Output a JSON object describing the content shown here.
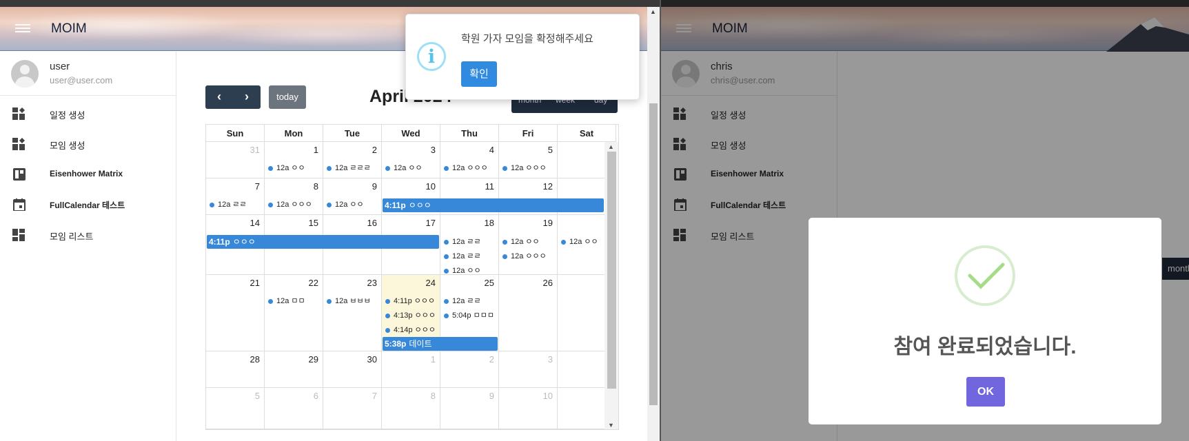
{
  "left_window": {
    "app_title": "MOIM",
    "user": {
      "name": "user",
      "email": "user@user.com"
    },
    "nav": [
      {
        "label": "일정 생성",
        "icon": "dashboard-add-icon"
      },
      {
        "label": "모임 생성",
        "icon": "dashboard-add-icon"
      },
      {
        "label": "Eisenhower Matrix",
        "icon": "board-icon"
      },
      {
        "label": "FullCalendar 테스트",
        "icon": "calendar-icon"
      },
      {
        "label": "모임 리스트",
        "icon": "dashboard-icon"
      }
    ],
    "calendar": {
      "prev": "‹",
      "next": "›",
      "today": "today",
      "title": "April 2024",
      "views": [
        "month",
        "week",
        "day"
      ],
      "dow": [
        "Sun",
        "Mon",
        "Tue",
        "Wed",
        "Thu",
        "Fri",
        "Sat"
      ],
      "weeks": [
        [
          {
            "d": "31",
            "o": true
          },
          {
            "d": "1"
          },
          {
            "d": "2"
          },
          {
            "d": "3"
          },
          {
            "d": "4"
          },
          {
            "d": "5"
          },
          {
            "d": ""
          }
        ],
        [
          {
            "d": "7"
          },
          {
            "d": "8"
          },
          {
            "d": "9"
          },
          {
            "d": "10"
          },
          {
            "d": "11"
          },
          {
            "d": "12"
          },
          {
            "d": ""
          }
        ],
        [
          {
            "d": "14"
          },
          {
            "d": "15"
          },
          {
            "d": "16"
          },
          {
            "d": "17"
          },
          {
            "d": "18"
          },
          {
            "d": "19"
          },
          {
            "d": ""
          }
        ],
        [
          {
            "d": "21"
          },
          {
            "d": "22"
          },
          {
            "d": "23"
          },
          {
            "d": "24",
            "today": true
          },
          {
            "d": "25"
          },
          {
            "d": "26"
          },
          {
            "d": ""
          }
        ],
        [
          {
            "d": "28"
          },
          {
            "d": "29"
          },
          {
            "d": "30"
          },
          {
            "d": "1",
            "o": true
          },
          {
            "d": "2",
            "o": true
          },
          {
            "d": "3",
            "o": true
          },
          {
            "d": ""
          }
        ],
        [
          {
            "d": "5",
            "o": true
          },
          {
            "d": "6",
            "o": true
          },
          {
            "d": "7",
            "o": true
          },
          {
            "d": "8",
            "o": true
          },
          {
            "d": "9",
            "o": true
          },
          {
            "d": "10",
            "o": true
          },
          {
            "d": ""
          }
        ]
      ],
      "events": [
        {
          "w": 0,
          "c": 1,
          "t": "12a ㅇㅇ"
        },
        {
          "w": 0,
          "c": 2,
          "t": "12a ㄹㄹㄹ"
        },
        {
          "w": 0,
          "c": 3,
          "t": "12a ㅇㅇ"
        },
        {
          "w": 0,
          "c": 4,
          "t": "12a ㅇㅇㅇ"
        },
        {
          "w": 0,
          "c": 5,
          "t": "12a ㅇㅇㅇ"
        },
        {
          "w": 1,
          "c": 0,
          "t": "12a ㄹㄹ"
        },
        {
          "w": 1,
          "c": 1,
          "t": "12a ㅇㅇㅇ"
        },
        {
          "w": 1,
          "c": 2,
          "t": "12a ㅇㅇ"
        },
        {
          "w": 2,
          "c": 4,
          "t": "12a ㄹㄹ"
        },
        {
          "w": 2,
          "c": 4,
          "t": "12a ㄹㄹ"
        },
        {
          "w": 2,
          "c": 4,
          "t": "12a ㅇㅇ"
        },
        {
          "w": 2,
          "c": 5,
          "t": "12a ㅇㅇ"
        },
        {
          "w": 2,
          "c": 5,
          "t": "12a ㅇㅇㅇ"
        },
        {
          "w": 2,
          "c": 6,
          "t": "12a ㅇㅇ"
        },
        {
          "w": 3,
          "c": 1,
          "t": "12a ㅁㅁ"
        },
        {
          "w": 3,
          "c": 2,
          "t": "12a ㅂㅂㅂ"
        },
        {
          "w": 3,
          "c": 3,
          "t": "4:11p ㅇㅇㅇ"
        },
        {
          "w": 3,
          "c": 3,
          "t": "4:13p ㅇㅇㅇ"
        },
        {
          "w": 3,
          "c": 3,
          "t": "4:14p ㅇㅇㅇ"
        },
        {
          "w": 3,
          "c": 4,
          "t": "12a ㄹㄹ"
        },
        {
          "w": 3,
          "c": 4,
          "t": "5:04p ㅁㅁㅁ"
        }
      ],
      "bars": [
        {
          "w": 1,
          "c1": 3,
          "c2": 6,
          "time": "4:11p",
          "t": "ㅇㅇㅇ"
        },
        {
          "w": 2,
          "c1": 0,
          "c2": 3,
          "time": "4:11p",
          "t": "ㅇㅇㅇ"
        },
        {
          "w": 3,
          "c1": 3,
          "c2": 4,
          "time": "5:38p",
          "t": "데이트"
        }
      ]
    },
    "toast": {
      "message": "학원 가자 모임을 확정해주세요",
      "confirm": "확인",
      "icon": "info-icon"
    }
  },
  "right_window": {
    "app_title": "MOIM",
    "user": {
      "name": "chris",
      "email": "chris@user.com"
    },
    "nav": [
      {
        "label": "일정 생성"
      },
      {
        "label": "모임 생성"
      },
      {
        "label": "Eisenhower Matrix"
      },
      {
        "label": "FullCalendar 테스트"
      },
      {
        "label": "모임 리스트"
      }
    ],
    "month_button": "month",
    "modal": {
      "title": "참여 완료되었습니다.",
      "ok": "OK",
      "icon": "success-check-icon"
    },
    "colors": {
      "accent": "#7266de",
      "check": "#a5dc86"
    }
  },
  "colors": {
    "event": "#3788d8",
    "today_bg": "#fcf6da",
    "nav_btn": "#2c3e50"
  }
}
